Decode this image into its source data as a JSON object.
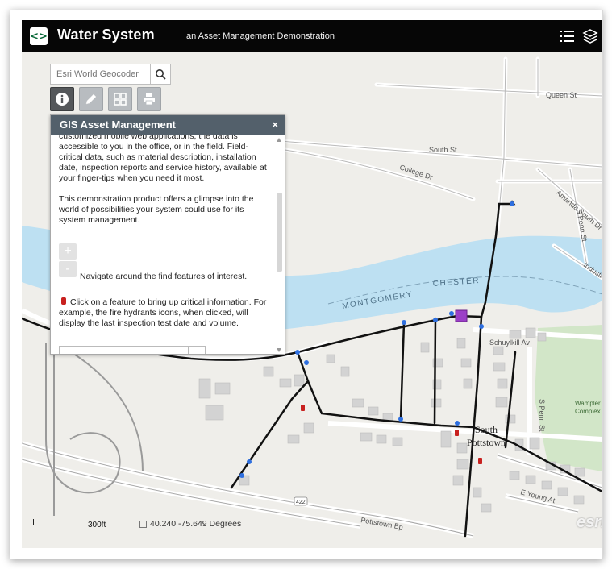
{
  "header": {
    "title": "Water System",
    "subtitle": "an Asset Management Demonstration",
    "logo_glyph": "<>",
    "logo_icon": "logo-icon",
    "list_icon": "list-icon",
    "layers_icon": "layers-icon"
  },
  "search": {
    "placeholder": "Esri World Geocoder",
    "button_icon": "search-icon"
  },
  "toolbar": [
    {
      "name": "info",
      "icon": "info-icon"
    },
    {
      "name": "edit",
      "icon": "pencil-icon"
    },
    {
      "name": "basemap",
      "icon": "grid-icon"
    },
    {
      "name": "print",
      "icon": "print-icon"
    }
  ],
  "panel": {
    "title": "GIS Asset Management",
    "close": "×",
    "para1": "customized mobile web applications, the data is accessible to you in the office, or in the field.  Field-critical data, such as material description, installation date, inspection reports and service history, available at your finger-tips when you need it most.",
    "para2": "This demonstration product offers a glimpse into the world of possibilities your system could use for its system management.",
    "zoom_in": "+",
    "zoom_out": "-",
    "nav_text": "Navigate around the find features of interest.",
    "hydrant_text": "Click on a feature to bring up critical information. For example, the fire hydrants icons, when clicked, will display the last inspection test date and volume."
  },
  "map": {
    "streets": {
      "queen": "Queen St",
      "south": "South St",
      "college": "College Dr",
      "amanda": "Amanda South Dr",
      "penn": "S Penn St",
      "schuylkill": "Schuylkill Av",
      "penn2": "S Penn St",
      "young": "E Young At",
      "pottstown": "Pottstown Bp",
      "industrial": "Industria",
      "route": "422"
    },
    "river_labels": [
      "MONTGOMERY",
      "CHESTER"
    ],
    "places": [
      "South",
      "Pottstown",
      "Wampler",
      "Complex"
    ],
    "scale": "300ft",
    "coordinates": "40.240  -75.649 Degrees",
    "attribution": "esri",
    "colors": {
      "water": "#bde0f2",
      "park": "#d2e6c8",
      "land": "#efeeea",
      "main": "#111111",
      "node": "#2e6fe0",
      "hydrant": "#c8211f",
      "pump": "#9b3fc7"
    }
  }
}
